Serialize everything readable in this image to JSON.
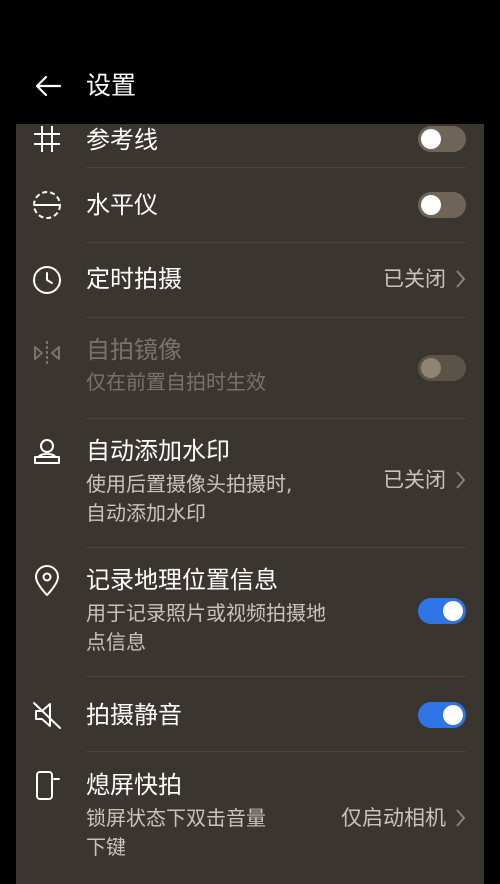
{
  "header": {
    "back_icon": "arrow-left-icon",
    "title": "设置"
  },
  "settings": [
    {
      "key": "grid",
      "icon": "grid-icon",
      "label": "参考线",
      "control": "toggle",
      "on": false
    },
    {
      "key": "level",
      "icon": "level-icon",
      "label": "水平仪",
      "control": "toggle",
      "on": false
    },
    {
      "key": "timer",
      "icon": "timer-icon",
      "label": "定时拍摄",
      "control": "value",
      "value": "已关闭"
    },
    {
      "key": "mirror",
      "icon": "mirror-icon",
      "label": "自拍镜像",
      "subtitle": "仅在前置自拍时生效",
      "control": "toggle",
      "on": false,
      "disabled": true
    },
    {
      "key": "watermark",
      "icon": "person-stamp-icon",
      "label": "自动添加水印",
      "subtitle_lines": [
        "使用后置摄像头拍摄时,",
        "自动添加水印"
      ],
      "control": "value",
      "value": "已关闭"
    },
    {
      "key": "location",
      "icon": "location-pin-icon",
      "label": "记录地理位置信息",
      "subtitle_lines": [
        "用于记录照片或视频拍摄地",
        "点信息"
      ],
      "control": "toggle",
      "on": true
    },
    {
      "key": "mute",
      "icon": "speaker-off-icon",
      "label": "拍摄静音",
      "control": "toggle",
      "on": true
    },
    {
      "key": "snapshot",
      "icon": "phone-volume-icon",
      "label": "熄屏快拍",
      "subtitle_lines": [
        "锁屏状态下双击音量",
        "下键"
      ],
      "control": "value",
      "value": "仅启动相机"
    }
  ],
  "colors": {
    "panel": "#3b3530",
    "toggle_on": "#2f74e5",
    "toggle_off": "#6e6458"
  }
}
